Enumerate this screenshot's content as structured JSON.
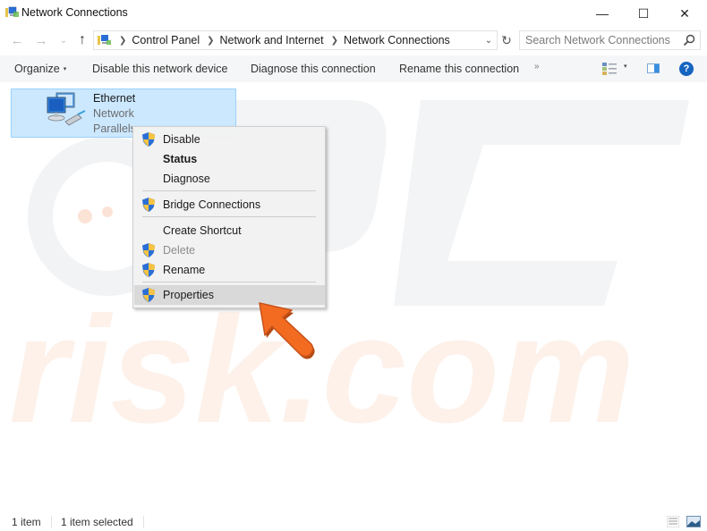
{
  "window": {
    "title": "Network Connections",
    "controls": {
      "minimize": "—",
      "maximize": "☐",
      "close": "✕"
    }
  },
  "navigation": {
    "back_glyph": "←",
    "forward_glyph": "→",
    "recent_glyph": "⌄",
    "up_glyph": "↑",
    "breadcrumb": [
      "Control Panel",
      "Network and Internet",
      "Network Connections"
    ],
    "separator": "❯",
    "dropdown_glyph": "⌄",
    "refresh_glyph": "↻",
    "search_placeholder": "Search Network Connections"
  },
  "commandbar": {
    "organize": "Organize",
    "caret": "▾",
    "disable_device": "Disable this network device",
    "diagnose": "Diagnose this connection",
    "rename": "Rename this connection",
    "more": "»",
    "help": "?"
  },
  "items": [
    {
      "name": "Ethernet",
      "status": "Network",
      "device": "Parallels",
      "selected": true
    }
  ],
  "context_menu": {
    "items": [
      {
        "label": "Disable",
        "shield": true,
        "bold": false,
        "disabled": false,
        "highlighted": false
      },
      {
        "label": "Status",
        "shield": false,
        "bold": true,
        "disabled": false,
        "highlighted": false
      },
      {
        "label": "Diagnose",
        "shield": false,
        "bold": false,
        "disabled": false,
        "highlighted": false
      },
      {
        "label": "Bridge Connections",
        "shield": true,
        "bold": false,
        "disabled": false,
        "highlighted": false
      },
      {
        "label": "Create Shortcut",
        "shield": false,
        "bold": false,
        "disabled": false,
        "highlighted": false
      },
      {
        "label": "Delete",
        "shield": true,
        "bold": false,
        "disabled": true,
        "highlighted": false
      },
      {
        "label": "Rename",
        "shield": true,
        "bold": false,
        "disabled": false,
        "highlighted": false
      },
      {
        "label": "Properties",
        "shield": true,
        "bold": false,
        "disabled": false,
        "highlighted": true
      }
    ]
  },
  "statusbar": {
    "count": "1 item",
    "selected": "1 item selected"
  },
  "colors": {
    "selection_bg": "#cce8ff",
    "selection_border": "#99d1ff",
    "help_blue": "#1564c0",
    "annotation_arrow": "#f26b21",
    "shield_blue": "#2a6fd6",
    "shield_yellow": "#f6c342"
  }
}
